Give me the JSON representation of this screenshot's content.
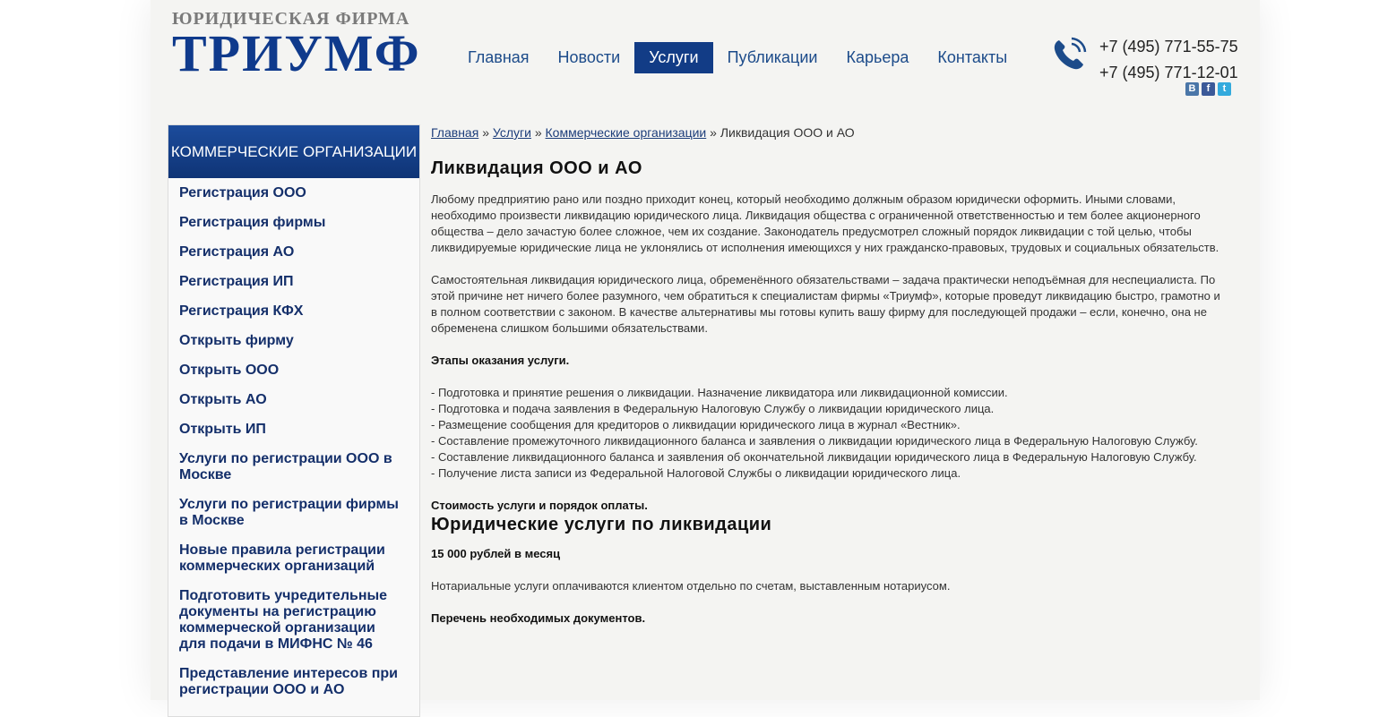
{
  "header": {
    "logo_top": "ЮРИДИЧЕСКАЯ ФИРМА",
    "logo_main": "ТРИУМФ",
    "nav": [
      "Главная",
      "Новости",
      "Услуги",
      "Публикации",
      "Карьера",
      "Контакты"
    ],
    "active_nav": "Услуги",
    "phones": [
      "+7 (495) 771-55-75",
      "+7 (495) 771-12-01"
    ],
    "social": [
      {
        "icon": "vk-icon",
        "glyph": "В"
      },
      {
        "icon": "facebook-icon",
        "glyph": "f"
      },
      {
        "icon": "twitter-icon",
        "glyph": "t"
      }
    ]
  },
  "sidebar": {
    "heading": "КОММЕРЧЕСКИЕ ОРГАНИЗАЦИИ",
    "items": [
      "Регистрация ООО",
      "Регистрация фирмы",
      "Регистрация АО",
      "Регистрация ИП",
      "Регистрация КФХ",
      "Открыть фирму",
      "Открыть ООО",
      "Открыть АО",
      "Открыть ИП",
      "Услуги по регистрации ООО в Москве",
      "Услуги по регистрации фирмы в Москве",
      "Новые правила регистрации коммерческих организаций",
      "Подготовить учредительные документы на регистрацию коммерческой организации для подачи в МИФНС № 46",
      "Представление интересов при регистрации ООО и АО"
    ]
  },
  "breadcrumbs": {
    "links": [
      "Главная",
      "Услуги",
      "Коммерческие организации"
    ],
    "current": "Ликвидация ООО и АО",
    "separator": "»"
  },
  "content": {
    "title": "Ликвидация ООО и АО",
    "p1": "Любому предприятию рано или поздно приходит конец, который необходимо должным образом юридически оформить. Иными словами, необходимо произвести ликвидацию юридического лица. Ликвидация общества с ограниченной ответственностью и тем более акционерного общества – дело  зачастую более сложное, чем их создание. Законодатель предусмотрел сложный порядок ликвидации с той целью, чтобы ликвидируемые юридические лица не уклонялись от исполнения имеющихся у них гражданско-правовых, трудовых и социальных обязательств.",
    "p2": "Самостоятельная ликвидация юридического лица, обременённого обязательствами – задача практически неподъёмная для неспециалиста. По этой причине нет ничего более разумного, чем обратиться к специалистам фирмы «Триумф», которые проведут ликвидацию быстро, грамотно и в полном соответствии с законом. В качестве альтернативы мы готовы купить вашу фирму для последующей продажи – если, конечно, она не обременена слишком большими обязательствами.",
    "stages_heading": "Этапы оказания услуги.",
    "stages": [
      "- Подготовка и принятие решения о ликвидации. Назначение ликвидатора или ликвидационной комиссии.",
      "- Подготовка и подача заявления в Федеральную Налоговую Службу о ликвидации юридического лица.",
      "- Размещение сообщения для кредиторов о ликвидации юридического лица в журнал «Вестник».",
      "- Составление промежуточного ликвидационного баланса и заявления о ликвидации юридического лица в Федеральную Налоговую Службу.",
      "- Составление ликвидационного баланса и заявления об окончательной ликвидации юридического лица в Федеральную Налоговую Службу.",
      "- Получение листа записи из Федеральной Налоговой Службы о ликвидации юридического лица."
    ],
    "cost_heading": "Стоимость услуги и порядок оплаты.",
    "subtitle": "Юридические услуги по ликвидации",
    "price": "15 000 рублей в месяц",
    "notary": "Нотариальные услуги оплачиваются клиентом отдельно по счетам, выставленным нотариусом.",
    "docs_heading": "Перечень необходимых документов."
  },
  "colors": {
    "brand_blue": "#123c86",
    "nav_text": "#1c4b8a",
    "page_bg": "#f4f4f2"
  }
}
